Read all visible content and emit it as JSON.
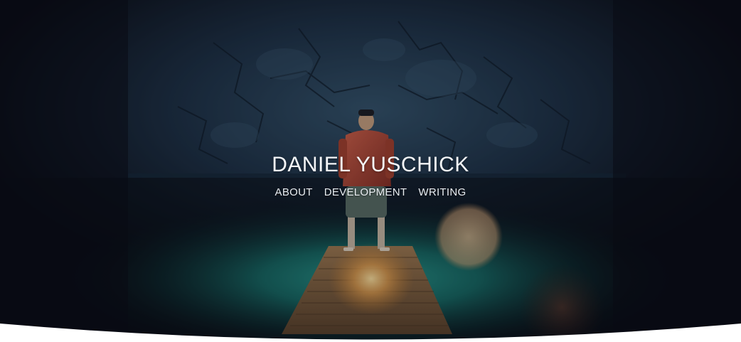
{
  "site": {
    "title": "DANIEL YUSCHICK"
  },
  "nav": {
    "items": [
      {
        "label": "ABOUT"
      },
      {
        "label": "DEVELOPMENT"
      },
      {
        "label": "WRITING"
      }
    ]
  },
  "colors": {
    "background_dark": "#0b0c15",
    "rock_blue": "#2f4a63",
    "water_teal": "#1b7a78",
    "jacket_red": "#b8463a",
    "dock_wood": "#8a6a48",
    "text_light": "#f4f6f8",
    "page_white": "#ffffff"
  },
  "hero_image": {
    "icon": "person-on-dock-photo"
  }
}
